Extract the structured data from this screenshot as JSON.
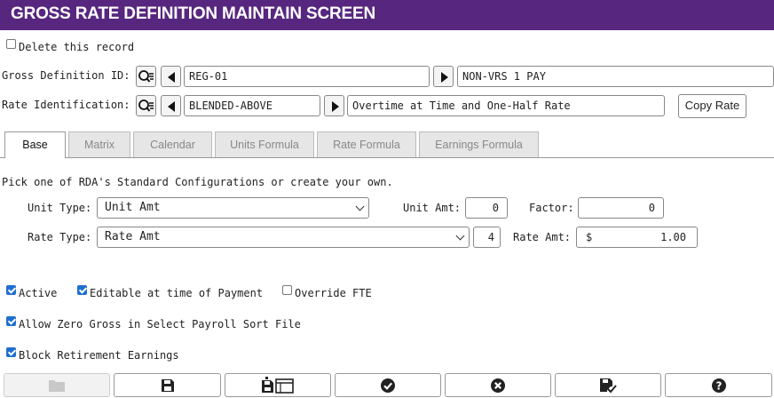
{
  "title": "GROSS RATE DEFINITION MAINTAIN SCREEN",
  "delete_record": {
    "label": "Delete this record",
    "checked": false
  },
  "gross_definition": {
    "label": "Gross Definition ID:",
    "id_value": "REG-01",
    "description": "NON-VRS 1 PAY"
  },
  "rate_identification": {
    "label": "Rate Identification:",
    "id_value": "BLENDED-ABOVE",
    "description": "Overtime at Time and One-Half Rate",
    "copy_button": "Copy Rate"
  },
  "tabs": [
    {
      "label": "Base",
      "active": true
    },
    {
      "label": "Matrix",
      "active": false
    },
    {
      "label": "Calendar",
      "active": false
    },
    {
      "label": "Units Formula",
      "active": false
    },
    {
      "label": "Rate Formula",
      "active": false
    },
    {
      "label": "Earnings Formula",
      "active": false
    }
  ],
  "base": {
    "intro": "Pick one of RDA's Standard Configurations or create your own.",
    "unit_type": {
      "label": "Unit Type:",
      "value": "Unit Amt"
    },
    "unit_amt": {
      "label": "Unit Amt:",
      "value": "0"
    },
    "factor": {
      "label": "Factor:",
      "value": "0"
    },
    "rate_type": {
      "label": "Rate Type:",
      "value": "Rate Amt",
      "decimals": "4"
    },
    "rate_amt": {
      "label": "Rate Amt:",
      "currency": "$",
      "value": "1.00"
    }
  },
  "options": {
    "active": {
      "label": "Active",
      "checked": true
    },
    "editable": {
      "label": "Editable at time of Payment",
      "checked": true
    },
    "override_fte": {
      "label": "Override FTE",
      "checked": false
    },
    "allow_zero": {
      "label": "Allow Zero Gross in Select Payroll Sort File",
      "checked": true
    },
    "block_retirement": {
      "label": "Block Retirement Earnings",
      "checked": true
    }
  },
  "toolbar": [
    {
      "icon": "folder-icon",
      "enabled": false
    },
    {
      "icon": "save-icon",
      "enabled": true
    },
    {
      "icon": "save-and-new-icon",
      "enabled": true
    },
    {
      "icon": "check-icon",
      "enabled": true
    },
    {
      "icon": "cancel-icon",
      "enabled": true
    },
    {
      "icon": "save-check-icon",
      "enabled": true
    },
    {
      "icon": "help-icon",
      "enabled": true
    }
  ],
  "colors": {
    "titlebar": "#57267f",
    "checkbox": "#1f6fd0"
  }
}
